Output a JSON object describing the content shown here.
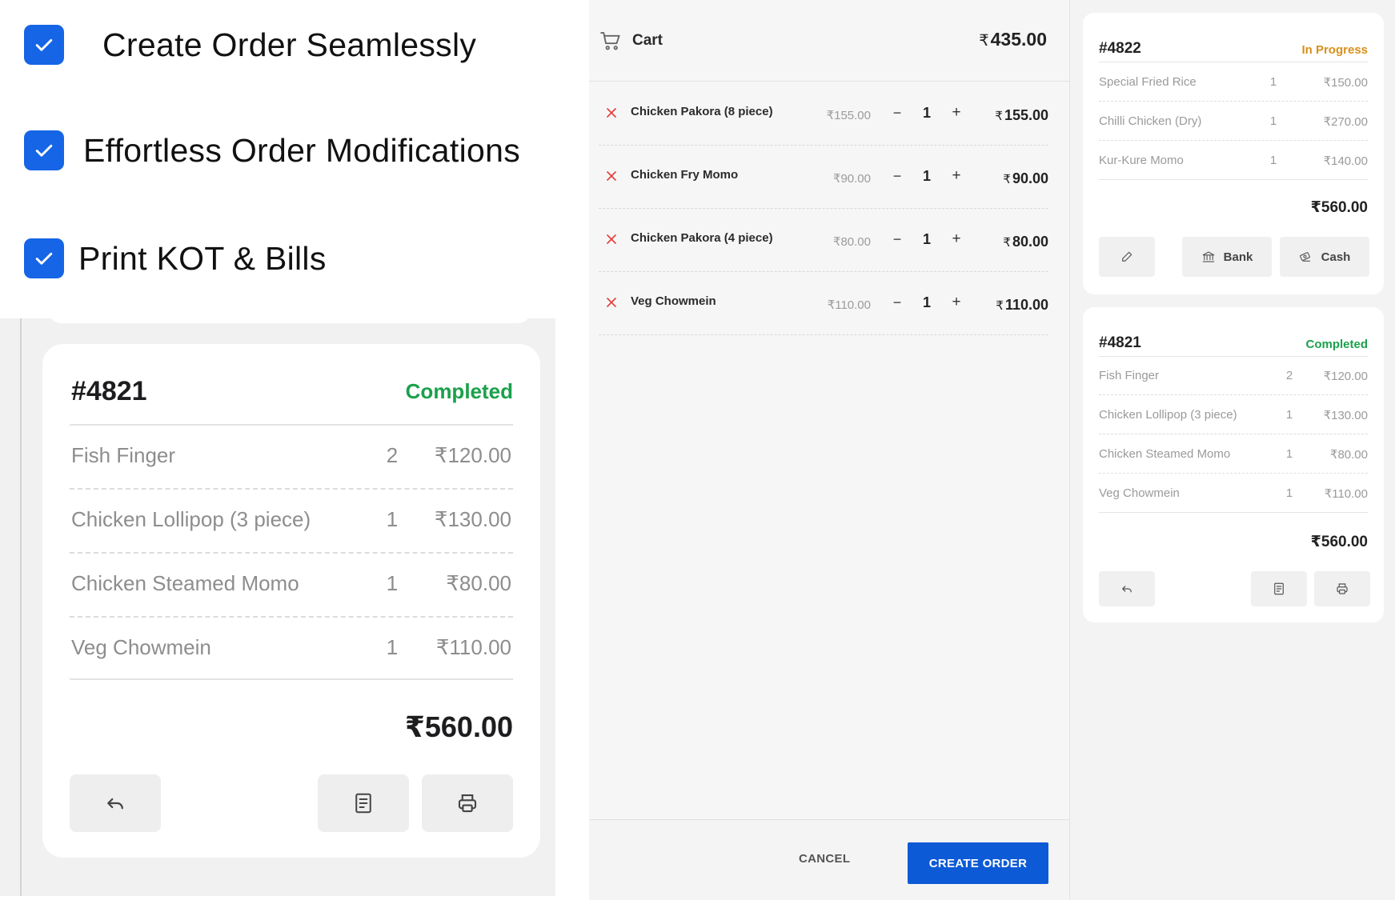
{
  "features": [
    {
      "label": "Create Order Seamlessly",
      "icon": "checkbox-checked-icon"
    },
    {
      "label": "Effortless Order Modifications",
      "icon": "checkbox-checked-icon"
    },
    {
      "label": "Print KOT & Bills",
      "icon": "checkbox-checked-icon"
    }
  ],
  "zoom_card": {
    "id": "#4821",
    "status": "Completed",
    "status_color": "#1aa14b",
    "items": [
      {
        "name": "Fish Finger",
        "qty": "2",
        "price": "₹120.00"
      },
      {
        "name": "Chicken Lollipop (3 piece)",
        "qty": "1",
        "price": "₹130.00"
      },
      {
        "name": "Chicken Steamed Momo",
        "qty": "1",
        "price": "₹80.00"
      },
      {
        "name": "Veg Chowmein",
        "qty": "1",
        "price": "₹110.00"
      }
    ],
    "total": "₹560.00",
    "buttons": [
      "undo-icon",
      "receipt-icon",
      "printer-icon"
    ]
  },
  "cart": {
    "title": "Cart",
    "total_symbol": "₹",
    "total": "435.00",
    "items": [
      {
        "name": "Chicken Pakora (8 piece)",
        "unit_price": "₹155.00",
        "minus": "−",
        "qty": "1",
        "plus": "+",
        "line_symbol": "₹",
        "line_total": "155.00"
      },
      {
        "name": "Chicken Fry Momo",
        "unit_price": "₹90.00",
        "minus": "−",
        "qty": "1",
        "plus": "+",
        "line_symbol": "₹",
        "line_total": "90.00"
      },
      {
        "name": "Chicken Pakora (4 piece)",
        "unit_price": "₹80.00",
        "minus": "−",
        "qty": "1",
        "plus": "+",
        "line_symbol": "₹",
        "line_total": "80.00"
      },
      {
        "name": "Veg Chowmein",
        "unit_price": "₹110.00",
        "minus": "−",
        "qty": "1",
        "plus": "+",
        "line_symbol": "₹",
        "line_total": "110.00"
      }
    ],
    "cancel_label": "CANCEL",
    "create_label": "CREATE ORDER",
    "accent": "#0d5ad6",
    "remove_color": "#e53935"
  },
  "orders": [
    {
      "id": "#4822",
      "status": "In Progress",
      "status_color": "#d9901a",
      "items": [
        {
          "name": "Special Fried Rice",
          "qty": "1",
          "price": "₹150.00"
        },
        {
          "name": "Chilli Chicken (Dry)",
          "qty": "1",
          "price": "₹270.00"
        },
        {
          "name": "Kur-Kure Momo",
          "qty": "1",
          "price": "₹140.00"
        }
      ],
      "total": "₹560.00",
      "actions": {
        "edit_icon": "pencil-icon",
        "bank_label": "Bank",
        "cash_label": "Cash"
      }
    },
    {
      "id": "#4821",
      "status": "Completed",
      "status_color": "#1aa14b",
      "items": [
        {
          "name": "Fish Finger",
          "qty": "2",
          "price": "₹120.00"
        },
        {
          "name": "Chicken Lollipop (3 piece)",
          "qty": "1",
          "price": "₹130.00"
        },
        {
          "name": "Chicken Steamed Momo",
          "qty": "1",
          "price": "₹80.00"
        },
        {
          "name": "Veg Chowmein",
          "qty": "1",
          "price": "₹110.00"
        }
      ],
      "total": "₹560.00",
      "actions": {
        "undo_icon": "undo-icon",
        "receipt_icon": "receipt-icon",
        "print_icon": "printer-icon"
      }
    }
  ]
}
